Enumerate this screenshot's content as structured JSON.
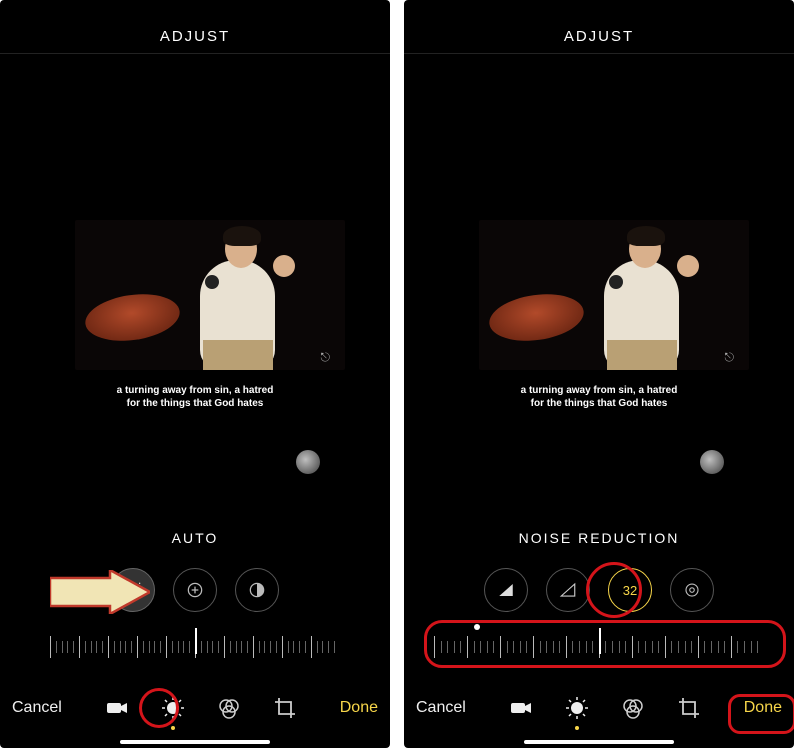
{
  "left": {
    "header": "ADJUST",
    "caption_line1": "a turning away from sin, a hatred",
    "caption_line2": "for the things that God hates",
    "tool_label": "AUTO",
    "cancel": "Cancel",
    "done": "Done",
    "loop_icon": "⎋"
  },
  "right": {
    "header": "ADJUST",
    "caption_line1": "a turning away from sin, a hatred",
    "caption_line2": "for the things that God hates",
    "tool_label": "NOISE REDUCTION",
    "noise_value": "32",
    "cancel": "Cancel",
    "done": "Done",
    "loop_icon": "⎋"
  },
  "colors": {
    "accent": "#f7d64a",
    "annotation": "#d4141a"
  }
}
